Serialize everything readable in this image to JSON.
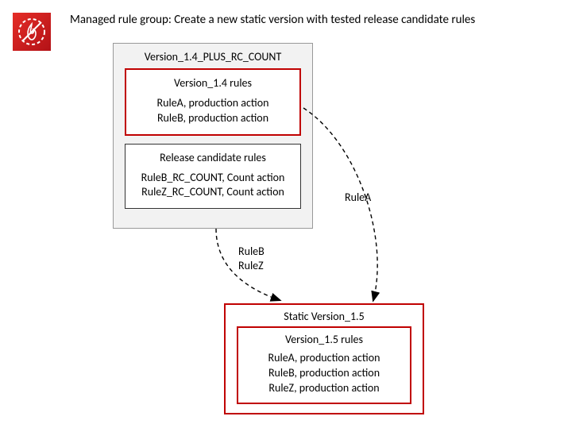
{
  "header": {
    "title": "Managed rule group: Create a new static version with tested release candidate rules"
  },
  "logo": {
    "name": "aws-waf-logo"
  },
  "rcContainer": {
    "title": "Version_1.4_PLUS_RC_COUNT",
    "versionBox": {
      "title": "Version_1.4 rules",
      "line1": "RuleA, production action",
      "line2": "RuleB, production action"
    },
    "candidateBox": {
      "title": "Release candidate rules",
      "line1": "RuleB_RC_COUNT, Count action",
      "line2": "RuleZ_RC_COUNT, Count action"
    }
  },
  "arrows": {
    "left": {
      "line1": "RuleB",
      "line2": "RuleZ"
    },
    "right": {
      "line1": "RuleA"
    }
  },
  "staticContainer": {
    "title": "Static Version_1.5",
    "innerBox": {
      "title": "Version_1.5 rules",
      "line1": "RuleA, production action",
      "line2": "RuleB, production action",
      "line3": "RuleZ, production action"
    }
  }
}
